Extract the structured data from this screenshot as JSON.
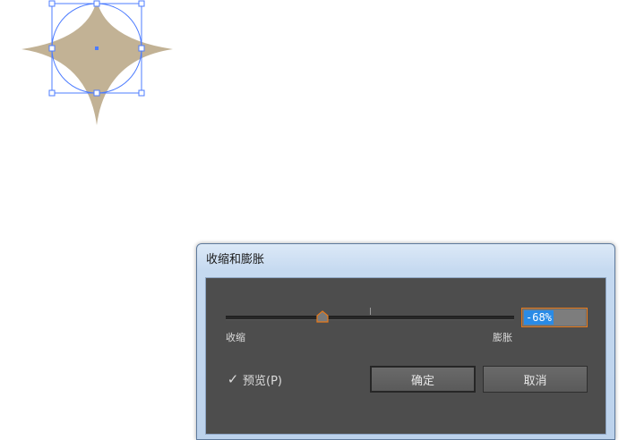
{
  "colors": {
    "shape_fill": "#c2b295",
    "selection_blue": "#4d7cff",
    "dialog_bg": "#4d4d4d",
    "focus_orange": "#e87a1a",
    "text_selection": "#2a8be6"
  },
  "dialog": {
    "title": "收缩和膨胀",
    "slider": {
      "label_left": "收缩",
      "label_right": "膨胀",
      "value_percent": -68
    },
    "value_field": {
      "value": "-68%"
    },
    "preview": {
      "checked": true,
      "check_glyph": "✓",
      "label": "预览(P)"
    },
    "buttons": {
      "ok_label": "确定",
      "cancel_label": "取消"
    }
  },
  "canvas": {
    "icons": [
      "star-shape",
      "selection-bounding-box",
      "selection-circle-path"
    ]
  }
}
